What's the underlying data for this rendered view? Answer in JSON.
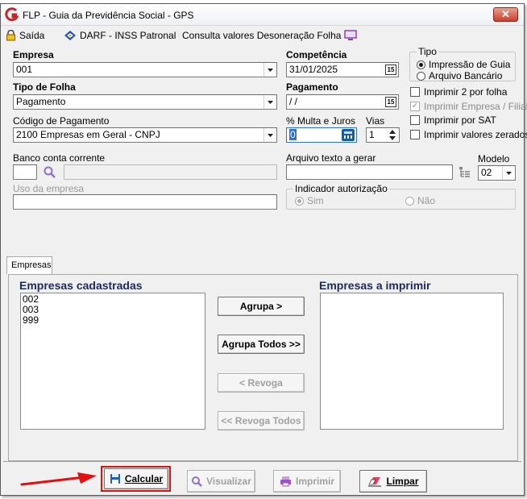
{
  "window": {
    "title": "FLP - Guia da Previdência Social - GPS",
    "close_label": "✕"
  },
  "menu": {
    "saida": "Saída",
    "darf": "DARF - INSS Patronal",
    "consulta": "Consulta valores Desoneração Folha"
  },
  "form": {
    "empresa": {
      "label": "Empresa",
      "value": "001"
    },
    "competencia": {
      "label": "Competência",
      "value": "31/01/2025",
      "cal_text": "15"
    },
    "tipo": {
      "label": "Tipo",
      "options": [
        "Impressão de Guia",
        "Arquivo Bancário"
      ],
      "selected": "Impressão de Guia"
    },
    "tipo_folha": {
      "label": "Tipo de Folha",
      "value": "Pagamento"
    },
    "pagamento": {
      "label": "Pagamento",
      "value": " / /",
      "cal_text": "15"
    },
    "checks": {
      "imprimir2": "Imprimir 2 por folha",
      "empresa_filial": "Imprimir Empresa / Filial",
      "sat": "Imprimir por SAT",
      "zerados": "Imprimir valores zerados"
    },
    "codigo_pagamento": {
      "label": "Código de Pagamento",
      "value": "2100  Empresas em Geral - CNPJ"
    },
    "multa": {
      "label": "% Multa e Juros",
      "value": "0"
    },
    "vias": {
      "label": "Vias",
      "value": "1"
    },
    "banco": {
      "label": "Banco conta corrente",
      "value": ""
    },
    "arquivo": {
      "label": "Arquivo texto a gerar",
      "value": ""
    },
    "modelo": {
      "label": "Modelo",
      "value": "02"
    },
    "uso_empresa": {
      "label": "Uso da empresa",
      "value": ""
    },
    "indicador": {
      "label": "Indicador autorização",
      "options": [
        "Sim",
        "Não"
      ],
      "selected": "Sim"
    }
  },
  "tabs": {
    "empresas": "Empresas"
  },
  "lists": {
    "cadastradas_title": "Empresas cadastradas",
    "cadastradas": [
      "002",
      "003",
      "999"
    ],
    "imprimir_title": "Empresas a imprimir",
    "imprimir": []
  },
  "move_buttons": {
    "agrupa": "Agrupa >",
    "agrupa_todos": "Agrupa Todos >>",
    "revoga": "< Revoga",
    "revoga_todos": "<< Revoga Todos"
  },
  "footer": {
    "calcular": "Calcular",
    "visualizar": "Visualizar",
    "imprimir": "Imprimir",
    "limpar": "Limpar"
  },
  "colors": {
    "accent_red": "#e01010",
    "title_blue": "#1c2a5c"
  }
}
